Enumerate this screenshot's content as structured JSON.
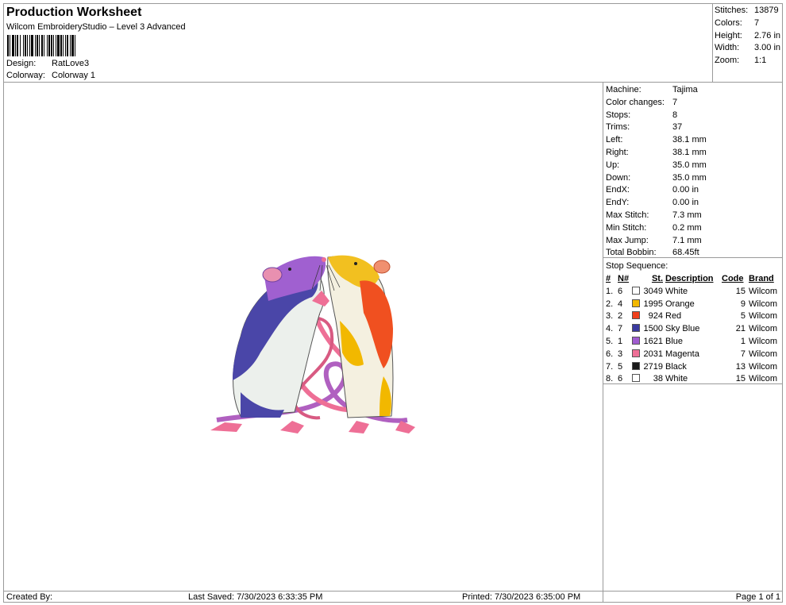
{
  "header": {
    "title": "Production Worksheet",
    "subtitle": "Wilcom EmbroideryStudio – Level 3 Advanced",
    "design_label": "Design:",
    "design_value": "RatLove3",
    "colorway_label": "Colorway:",
    "colorway_value": "Colorway 1"
  },
  "summary": [
    {
      "label": "Stitches:",
      "value": "13879"
    },
    {
      "label": "Colors:",
      "value": "7"
    },
    {
      "label": "Height:",
      "value": "2.76 in"
    },
    {
      "label": "Width:",
      "value": "3.00 in"
    },
    {
      "label": "Zoom:",
      "value": "1:1"
    }
  ],
  "stats": [
    {
      "label": "Machine:",
      "value": "Tajima"
    },
    {
      "label": "Color changes:",
      "value": "7"
    },
    {
      "label": "Stops:",
      "value": "8"
    },
    {
      "label": "Trims:",
      "value": "37"
    },
    {
      "label": "Left:",
      "value": "38.1 mm"
    },
    {
      "label": "Right:",
      "value": "38.1 mm"
    },
    {
      "label": "Up:",
      "value": "35.0 mm"
    },
    {
      "label": "Down:",
      "value": "35.0 mm"
    },
    {
      "label": "EndX:",
      "value": "0.00 in"
    },
    {
      "label": "EndY:",
      "value": "0.00 in"
    },
    {
      "label": "Max Stitch:",
      "value": "7.3 mm"
    },
    {
      "label": "Min Stitch:",
      "value": "0.2 mm"
    },
    {
      "label": "Max Jump:",
      "value": "7.1 mm"
    },
    {
      "label": "Total Bobbin:",
      "value": "68.45ft"
    }
  ],
  "stop_sequence": {
    "caption": "Stop Sequence:",
    "columns": [
      "#",
      "N#",
      "St.",
      "Description",
      "Code",
      "Brand"
    ],
    "rows": [
      {
        "num": "1.",
        "n": "6",
        "color": "#ffffff",
        "st": "3049",
        "desc": "White",
        "code": "15",
        "brand": "Wilcom"
      },
      {
        "num": "2.",
        "n": "4",
        "color": "#f2b800",
        "st": "1995",
        "desc": "Orange",
        "code": "9",
        "brand": "Wilcom"
      },
      {
        "num": "3.",
        "n": "2",
        "color": "#f0401c",
        "st": "924",
        "desc": "Red",
        "code": "5",
        "brand": "Wilcom"
      },
      {
        "num": "4.",
        "n": "7",
        "color": "#3a3aa0",
        "st": "1500",
        "desc": "Sky Blue",
        "code": "21",
        "brand": "Wilcom"
      },
      {
        "num": "5.",
        "n": "1",
        "color": "#a05cd0",
        "st": "1621",
        "desc": "Blue",
        "code": "1",
        "brand": "Wilcom"
      },
      {
        "num": "6.",
        "n": "3",
        "color": "#ee6f96",
        "st": "2031",
        "desc": "Magenta",
        "code": "7",
        "brand": "Wilcom"
      },
      {
        "num": "7.",
        "n": "5",
        "color": "#1a1a1a",
        "st": "2719",
        "desc": "Black",
        "code": "13",
        "brand": "Wilcom"
      },
      {
        "num": "8.",
        "n": "6",
        "color": "#ffffff",
        "st": "38",
        "desc": "White",
        "code": "15",
        "brand": "Wilcom"
      }
    ]
  },
  "footer": {
    "created_by": "Created By:",
    "last_saved": "Last Saved: 7/30/2023 6:33:35 PM",
    "printed": "Printed: 7/30/2023 6:35:00 PM",
    "page": "Page 1 of 1"
  }
}
